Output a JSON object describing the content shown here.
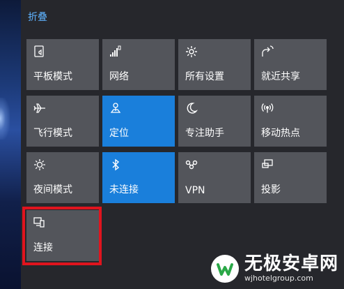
{
  "header": {
    "collapse_label": "折叠"
  },
  "tiles": [
    {
      "label": "平板模式",
      "icon": "tablet-mode-icon",
      "active": false
    },
    {
      "label": "网络",
      "icon": "network-icon",
      "active": false
    },
    {
      "label": "所有设置",
      "icon": "gear-icon",
      "active": false
    },
    {
      "label": "就近共享",
      "icon": "nearby-share-icon",
      "active": false
    },
    {
      "label": "飞行模式",
      "icon": "airplane-icon",
      "active": false
    },
    {
      "label": "定位",
      "icon": "location-icon",
      "active": true
    },
    {
      "label": "专注助手",
      "icon": "moon-icon",
      "active": false
    },
    {
      "label": "移动热点",
      "icon": "hotspot-icon",
      "active": false
    },
    {
      "label": "夜间模式",
      "icon": "brightness-icon",
      "active": false
    },
    {
      "label": "未连接",
      "icon": "bluetooth-icon",
      "active": true
    },
    {
      "label": "VPN",
      "icon": "vpn-icon",
      "active": false
    },
    {
      "label": "投影",
      "icon": "project-icon",
      "active": false
    },
    {
      "label": "连接",
      "icon": "connect-icon",
      "active": false
    }
  ],
  "colors": {
    "tile": "#53555b",
    "tile_active": "#1a7fdb",
    "accent_text": "#5fb3ff",
    "highlight": "#e0141e"
  },
  "watermark": {
    "title": "无极安卓网",
    "url": "wjhotelgroup.com"
  }
}
